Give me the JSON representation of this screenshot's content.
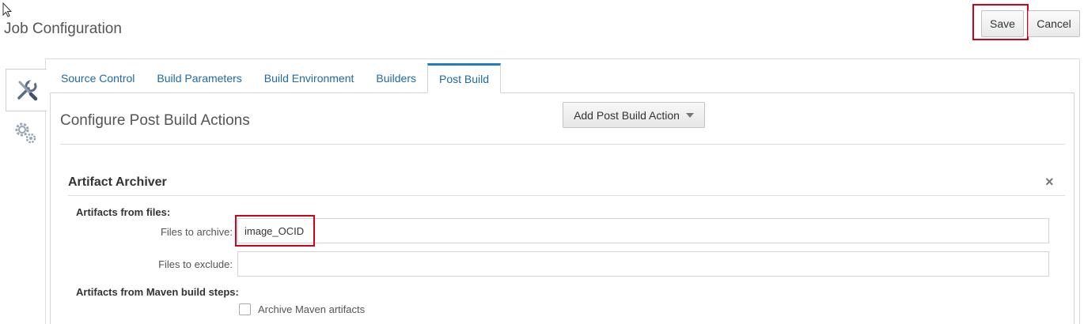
{
  "header": {
    "title": "Job Configuration",
    "save_label": "Save",
    "cancel_label": "Cancel"
  },
  "side_tabs": [
    {
      "icon": "tools-icon"
    },
    {
      "icon": "gears-icon"
    }
  ],
  "tabs": [
    {
      "label": "Source Control",
      "active": false
    },
    {
      "label": "Build Parameters",
      "active": false
    },
    {
      "label": "Build Environment",
      "active": false
    },
    {
      "label": "Builders",
      "active": false
    },
    {
      "label": "Post Build",
      "active": true
    }
  ],
  "post_build": {
    "title": "Configure Post Build Actions",
    "add_action_label": "Add Post Build Action"
  },
  "artifact_archiver": {
    "title": "Artifact Archiver",
    "close_glyph": "×",
    "files_group_label": "Artifacts from files:",
    "archive_label": "Files to archive:",
    "archive_value": "image_OCID",
    "exclude_label": "Files to exclude:",
    "exclude_value": "",
    "maven_group_label": "Artifacts from Maven build steps:",
    "maven_checkbox_label": "Archive Maven artifacts",
    "maven_checked": false
  },
  "colors": {
    "highlight": "#d0021b",
    "tab_link": "#1f6aa5",
    "tab_active_border": "#1f7ec2"
  }
}
